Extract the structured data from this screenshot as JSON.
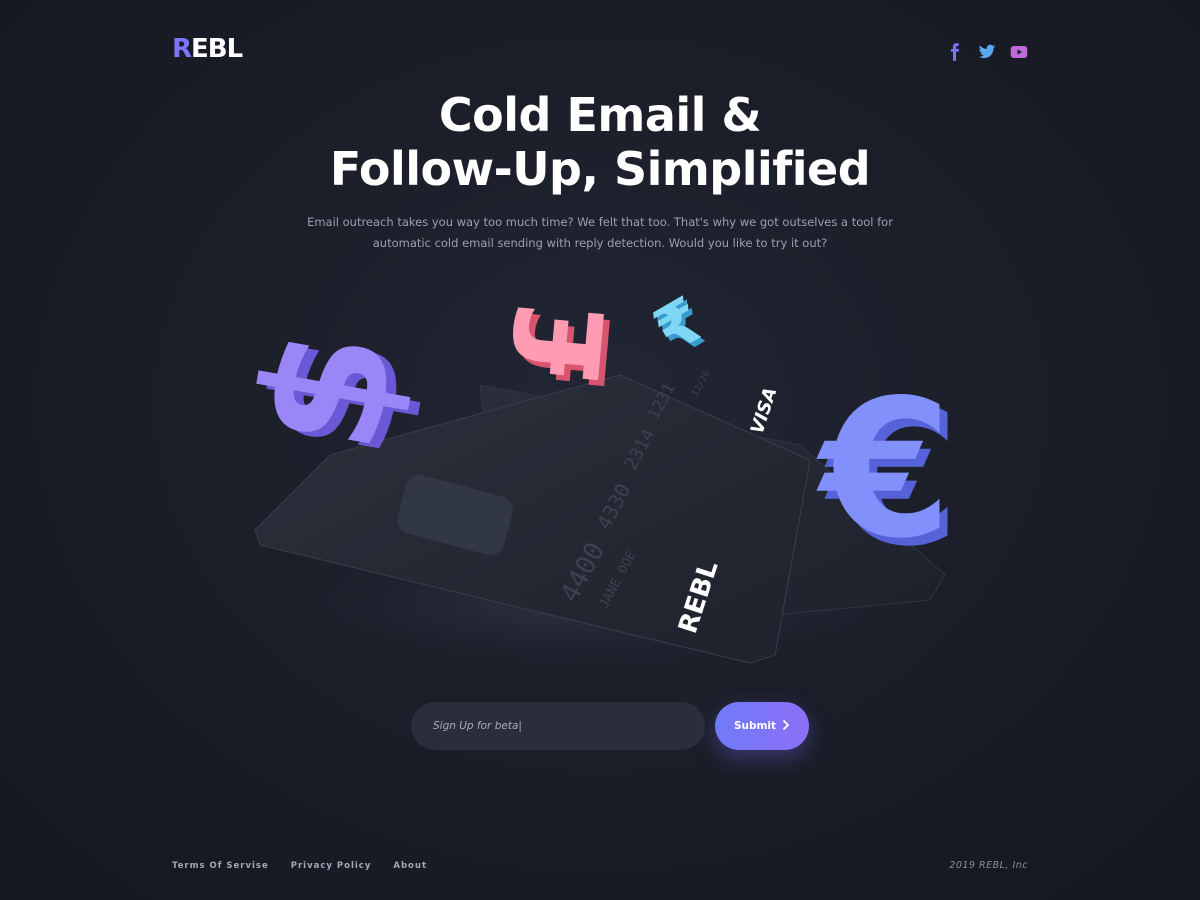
{
  "brand": {
    "logo_text": "REBL",
    "accent": "#7c73ff"
  },
  "socials": [
    {
      "name": "facebook",
      "icon": "facebook-icon",
      "color": "#7c73ff"
    },
    {
      "name": "twitter",
      "icon": "twitter-icon",
      "color": "#5aa9f0"
    },
    {
      "name": "youtube",
      "icon": "youtube-icon",
      "color": "#c06ad8"
    }
  ],
  "hero": {
    "title_line1": "Cold Email &",
    "title_line2": "Follow-Up, Simplified",
    "subtitle": "Email outreach takes you way too much time? We felt that too. That's why we got outselves a tool for automatic cold email sending with reply detection. Would you like to try it out?"
  },
  "illustration": {
    "card_number_part1": "4400",
    "card_number_part2": "4330",
    "card_number_part3": "2314",
    "card_number_part4": "1231",
    "card_holder": "JANE DOE",
    "card_expiry": "12/26",
    "card_brand": "VISA",
    "card_logo": "REBL",
    "symbols": [
      "$",
      "£",
      "₹",
      "€"
    ],
    "colors": {
      "dollar": "#8f7af3",
      "pound": "#f06f8e",
      "rupee": "#5fc8f0",
      "euro": "#6f7bf0"
    }
  },
  "signup": {
    "placeholder": "Sign Up for beta|",
    "button_label": "Submit",
    "button_icon": "chevron-right-icon"
  },
  "footer": {
    "links": [
      "Terms Of Servise",
      "Privacy Policy",
      "About"
    ],
    "copyright": "2019 REBL, Inc"
  }
}
